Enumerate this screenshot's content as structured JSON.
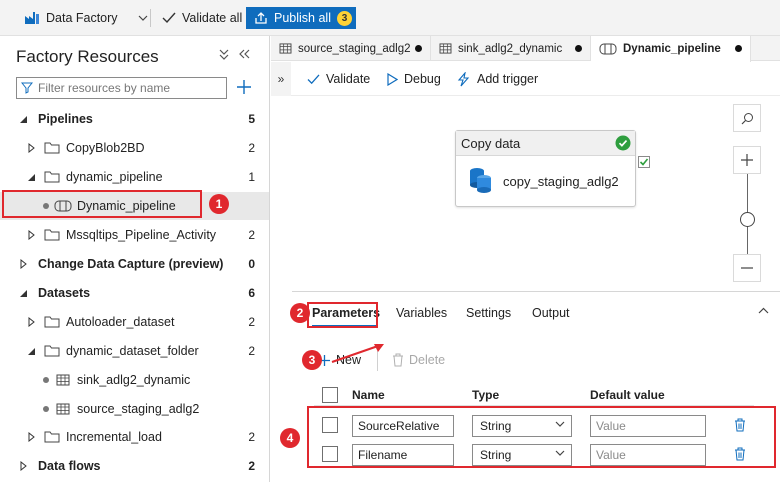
{
  "toolbar": {
    "factory_label": "Data Factory",
    "validate_all_label": "Validate all",
    "publish_all_label": "Publish all",
    "publish_count": "3"
  },
  "left_panel": {
    "title": "Factory Resources",
    "filter_placeholder": "Filter resources by name",
    "sections": {
      "pipelines": {
        "label": "Pipelines",
        "count": "5"
      },
      "cdc": {
        "label": "Change Data Capture (preview)",
        "count": "0"
      },
      "datasets": {
        "label": "Datasets",
        "count": "6"
      },
      "dataflows": {
        "label": "Data flows",
        "count": "2"
      }
    },
    "items": {
      "copyblob": {
        "label": "CopyBlob2BD",
        "count": "2"
      },
      "dynamic_folder": {
        "label": "dynamic_pipeline",
        "count": "1"
      },
      "dynamic_pipeline": {
        "label": "Dynamic_pipeline"
      },
      "mssql": {
        "label": "Mssqltips_Pipeline_Activity",
        "count": "2"
      },
      "autoloader": {
        "label": "Autoloader_dataset",
        "count": "2"
      },
      "dyn_dataset_folder": {
        "label": "dynamic_dataset_folder",
        "count": "2"
      },
      "sink_ds": {
        "label": "sink_adlg2_dynamic"
      },
      "source_ds": {
        "label": "source_staging_adlg2"
      },
      "incremental": {
        "label": "Incremental_load",
        "count": "2"
      }
    }
  },
  "tabs": [
    {
      "label": "source_staging_adlg2"
    },
    {
      "label": "sink_adlg2_dynamic"
    },
    {
      "label": "Dynamic_pipeline"
    }
  ],
  "canvas_toolbar": {
    "validate": "Validate",
    "debug": "Debug",
    "add_trigger": "Add trigger"
  },
  "activity": {
    "type": "Copy data",
    "name": "copy_staging_adlg2",
    "status": "succeeded"
  },
  "properties": {
    "tabs": [
      "Parameters",
      "Variables",
      "Settings",
      "Output"
    ],
    "new_label": "New",
    "delete_label": "Delete",
    "columns": {
      "name": "Name",
      "type": "Type",
      "default": "Default value"
    },
    "rows": [
      {
        "name": "SourceRelative",
        "type": "String",
        "default_placeholder": "Value"
      },
      {
        "name": "Filename",
        "type": "String",
        "default_placeholder": "Value"
      }
    ]
  },
  "annotations": [
    "1",
    "2",
    "3",
    "4"
  ],
  "colors": {
    "accent": "#0f6cbd",
    "annotation_red": "#e0282e",
    "success_green": "#2e9e3e",
    "badge_yellow": "#ffd335"
  }
}
